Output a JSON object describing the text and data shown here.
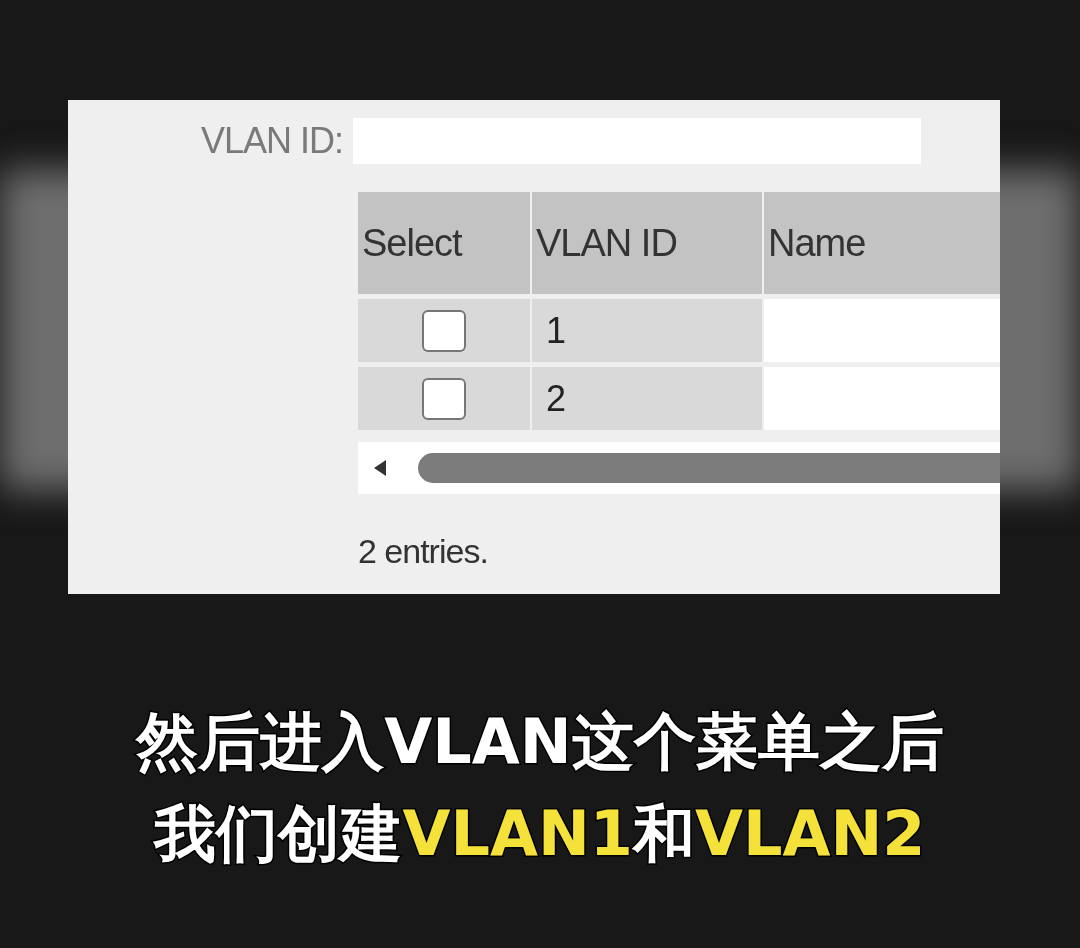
{
  "form": {
    "vlan_id_label": "VLAN ID:"
  },
  "table": {
    "columns": [
      "Select",
      "VLAN ID",
      "Name"
    ],
    "rows": [
      {
        "checked": false,
        "vlan_id": "1"
      },
      {
        "checked": false,
        "vlan_id": "2"
      }
    ]
  },
  "entries_text": "2 entries.",
  "caption": {
    "lines": [
      [
        {
          "text": "然后进入VLAN这个菜单之后",
          "highlight": false
        }
      ],
      [
        {
          "text": "我们创建",
          "highlight": false
        },
        {
          "text": "VLAN1",
          "highlight": true
        },
        {
          "text": "和",
          "highlight": false
        },
        {
          "text": "VLAN2",
          "highlight": true
        }
      ]
    ]
  }
}
